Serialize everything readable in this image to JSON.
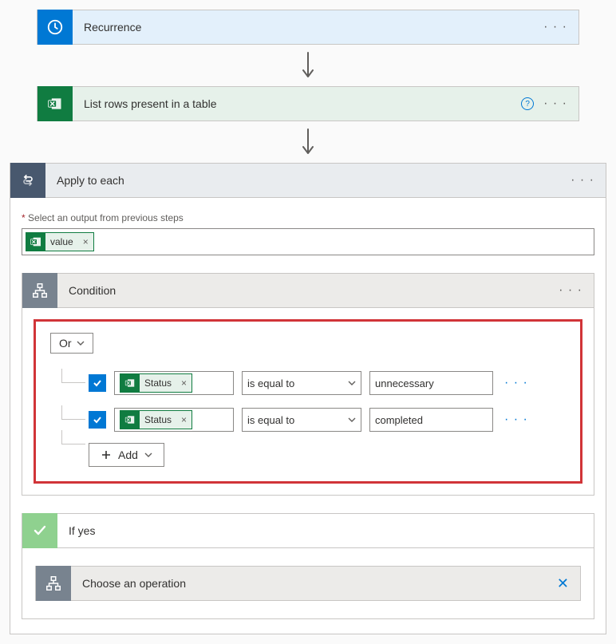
{
  "steps": {
    "recurrence": {
      "title": "Recurrence"
    },
    "listRows": {
      "title": "List rows present in a table"
    },
    "applyEach": {
      "title": "Apply to each"
    },
    "condition": {
      "title": "Condition"
    },
    "ifYes": {
      "title": "If yes"
    },
    "chooseOp": {
      "title": "Choose an operation"
    }
  },
  "applyEach": {
    "fieldLabel": "Select an output from previous steps",
    "valueChip": "value"
  },
  "condition": {
    "group": "Or",
    "addLabel": "Add",
    "rows": [
      {
        "left": "Status",
        "op": "is equal to",
        "right": "unnecessary"
      },
      {
        "left": "Status",
        "op": "is equal to",
        "right": "completed"
      }
    ]
  }
}
